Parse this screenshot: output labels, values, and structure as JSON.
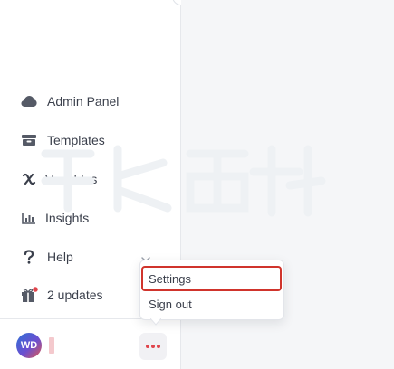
{
  "nav": {
    "items": [
      {
        "label": "Admin Panel",
        "icon": "cloud-icon"
      },
      {
        "label": "Templates",
        "icon": "templates-icon"
      },
      {
        "label": "Variables",
        "icon": "variable-x-icon"
      },
      {
        "label": "Insights",
        "icon": "bar-chart-icon"
      },
      {
        "label": "Help",
        "icon": "question-icon"
      },
      {
        "label": "2 updates",
        "icon": "gift-icon"
      }
    ]
  },
  "user": {
    "initials": "WD"
  },
  "menu": {
    "items": [
      {
        "label": "Settings",
        "selected": true
      },
      {
        "label": "Sign out",
        "selected": false
      }
    ]
  },
  "colors": {
    "accent_red": "#e0454c",
    "highlight_border": "#d0342c",
    "sidebar_bg": "#ffffff",
    "main_bg": "#f5f6f8",
    "text": "#3a3f4b"
  }
}
